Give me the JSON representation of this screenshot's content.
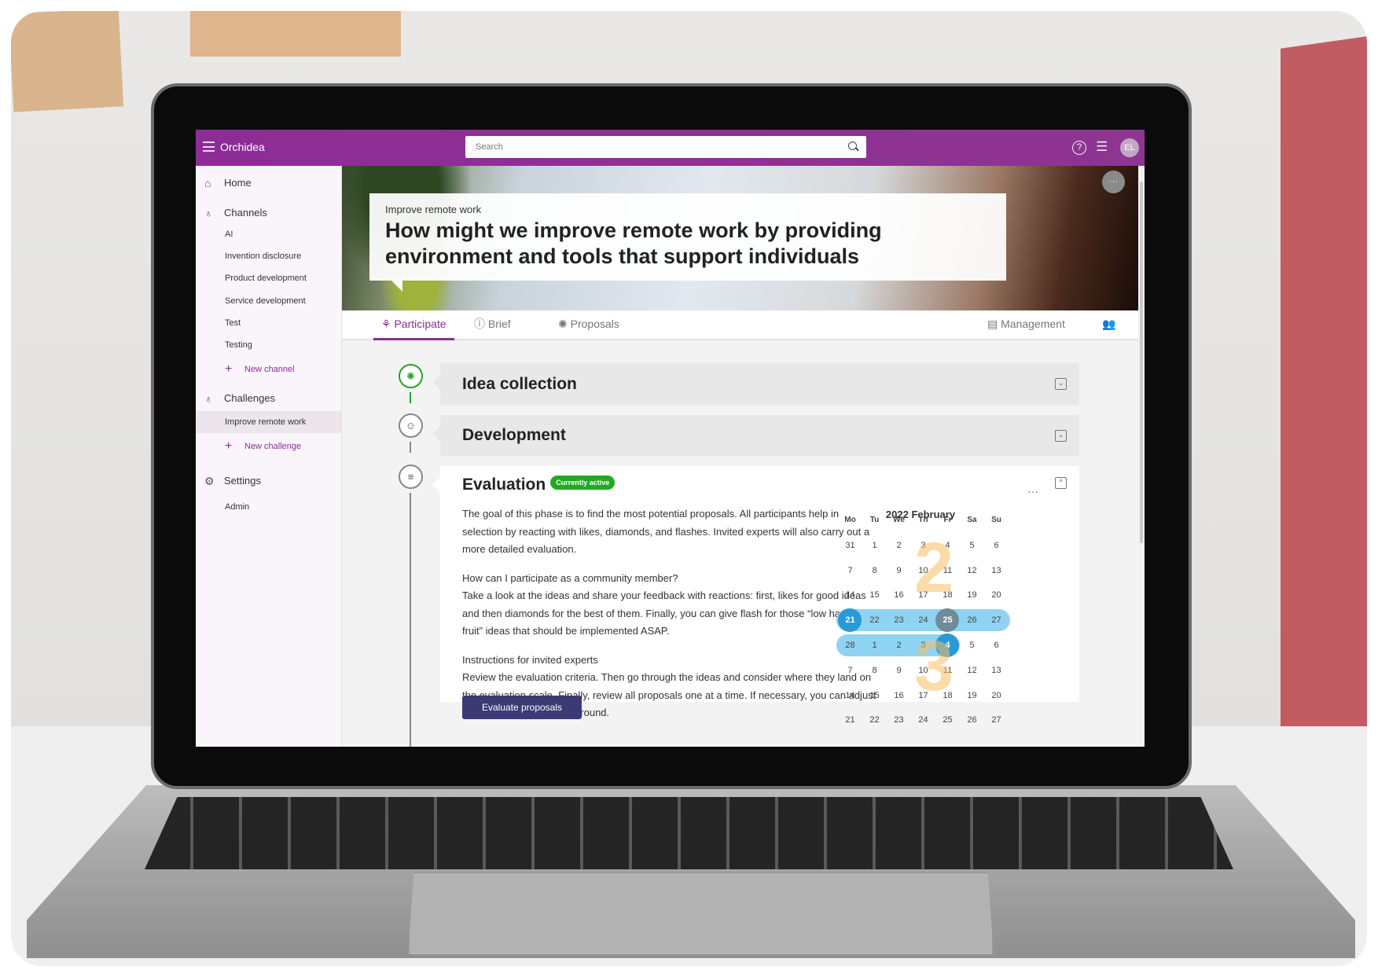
{
  "app": {
    "name": "Orchidea",
    "user_initials": "EL"
  },
  "search": {
    "placeholder": "Search"
  },
  "sidebar": {
    "home": "Home",
    "channels": {
      "label": "Channels",
      "items": [
        "AI",
        "Invention disclosure",
        "Product development",
        "Service development",
        "Test",
        "Testing"
      ],
      "add": "New channel"
    },
    "challenges": {
      "label": "Challenges",
      "items": [
        "Improve remote work"
      ],
      "add": "New challenge"
    },
    "settings": {
      "label": "Settings",
      "items": [
        "Admin"
      ]
    }
  },
  "hero": {
    "kicker": "Improve remote work",
    "title": "How might we improve remote work by providing environment and tools that support individuals"
  },
  "tabs": {
    "participate": "Participate",
    "brief": "Brief",
    "proposals": "Proposals",
    "management": "Management"
  },
  "phases": {
    "idea": "Idea collection",
    "development": "Development",
    "evaluation": {
      "title": "Evaluation",
      "badge": "Currently active",
      "p1": "The goal of this phase is to find the most potential proposals. All participants help in selection by reacting with likes, diamonds, and flashes. Invited experts will also carry out a more detailed evaluation.",
      "q2": "How can I participate as a community member?",
      "p2": "Take a look at the ideas and share your feedback with reactions: first, likes for good ideas and then diamonds for the best of them. Finally, you can give flash for those “low hanging fruit” ideas that should be implemented ASAP.",
      "q3": "Instructions for invited experts",
      "p3": "Review the evaluation criteria. Then go through the ideas and consider where they land on the evaluation scale. Finally, review all proposals one at a time. If necessary, you can adjust your scoring after the first round.",
      "button": "Evaluate proposals"
    }
  },
  "calendar": {
    "title": "2022 February",
    "weekdays": [
      "Mo",
      "Tu",
      "We",
      "Th",
      "Fr",
      "Sa",
      "Su"
    ],
    "weeks": [
      [
        "31",
        "1",
        "2",
        "3",
        "4",
        "5",
        "6"
      ],
      [
        "7",
        "8",
        "9",
        "10",
        "11",
        "12",
        "13"
      ],
      [
        "14",
        "15",
        "16",
        "17",
        "18",
        "19",
        "20"
      ],
      [
        "21",
        "22",
        "23",
        "24",
        "25",
        "26",
        "27"
      ],
      [
        "28",
        "1",
        "2",
        "3",
        "4",
        "5",
        "6"
      ],
      [
        "7",
        "8",
        "9",
        "10",
        "11",
        "12",
        "13"
      ],
      [
        "14",
        "15",
        "16",
        "17",
        "18",
        "19",
        "20"
      ],
      [
        "21",
        "22",
        "23",
        "24",
        "25",
        "26",
        "27"
      ]
    ],
    "overlay_numbers": [
      "2",
      "3"
    ],
    "colors": {
      "range": "#8fd3f3",
      "endpoint": "#2a9ad6",
      "today": "#6f8c98",
      "accent": "#8e2c97",
      "active_badge": "#22a922"
    }
  }
}
